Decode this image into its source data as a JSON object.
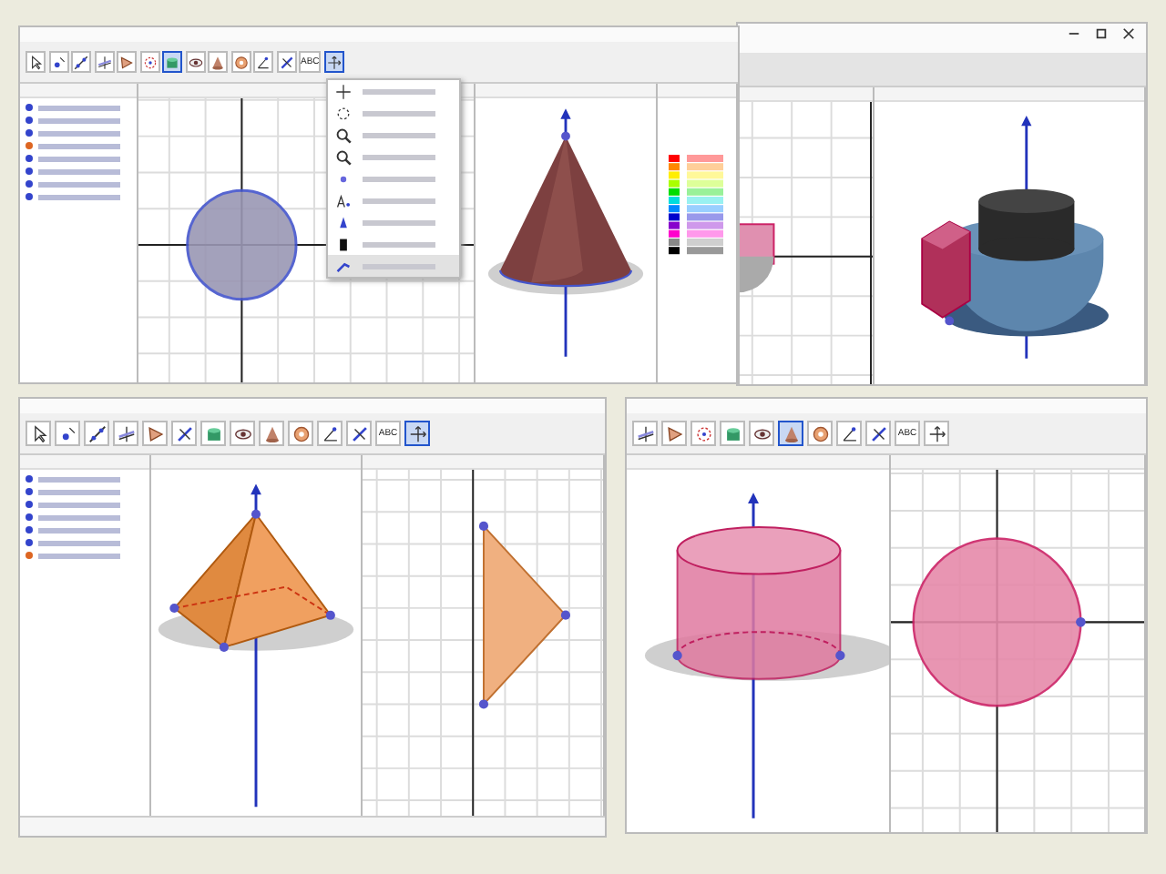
{
  "windows": [
    {
      "toolbar": [
        {
          "kind": "move",
          "selected": false
        },
        {
          "kind": "point",
          "selected": false
        },
        {
          "kind": "line",
          "selected": false
        },
        {
          "kind": "perp",
          "selected": false
        },
        {
          "kind": "polygon",
          "selected": false
        },
        {
          "kind": "circle",
          "selected": false
        },
        {
          "kind": "solid",
          "selected": true
        },
        {
          "kind": "eye",
          "selected": false
        },
        {
          "kind": "cone",
          "selected": false
        },
        {
          "kind": "sphere",
          "selected": false
        },
        {
          "kind": "angle",
          "selected": false
        },
        {
          "kind": "reflect",
          "selected": false
        },
        {
          "kind": "text",
          "label": "ABC",
          "selected": false
        },
        {
          "kind": "view",
          "selected": true
        }
      ],
      "dropdown": {
        "items": [
          {
            "kind": "move-view",
            "selected": false
          },
          {
            "kind": "rotate",
            "selected": false
          },
          {
            "kind": "zoom-in",
            "selected": false
          },
          {
            "kind": "zoom-out",
            "selected": false
          },
          {
            "kind": "show-hide",
            "selected": false
          },
          {
            "kind": "label",
            "selected": false
          },
          {
            "kind": "style",
            "selected": false
          },
          {
            "kind": "delete",
            "selected": false
          },
          {
            "kind": "view",
            "selected": true
          }
        ]
      },
      "views": [
        {
          "kind": "algebra",
          "rows": [
            {
              "color": "#3344cc"
            },
            {
              "color": "#3344cc"
            },
            {
              "color": "#3344cc"
            },
            {
              "color": "#dd6622"
            },
            {
              "color": "#3344cc"
            },
            {
              "color": "#3344cc"
            },
            {
              "color": "#3344cc"
            },
            {
              "color": "#3344cc"
            }
          ]
        },
        {
          "kind": "circle-2d"
        },
        {
          "kind": "cone-3d"
        },
        {
          "kind": "style-panel"
        }
      ]
    },
    {
      "views": [
        {
          "kind": "partial-2d"
        },
        {
          "kind": "solids-3d"
        }
      ]
    },
    {
      "toolbar": [
        {
          "kind": "move",
          "selected": false
        },
        {
          "kind": "point",
          "selected": false
        },
        {
          "kind": "line",
          "selected": false
        },
        {
          "kind": "perp",
          "selected": false
        },
        {
          "kind": "polygon",
          "selected": false
        },
        {
          "kind": "reflect",
          "selected": false
        },
        {
          "kind": "solid",
          "selected": false
        },
        {
          "kind": "eye",
          "selected": false
        },
        {
          "kind": "cone",
          "selected": false
        },
        {
          "kind": "sphere",
          "selected": false
        },
        {
          "kind": "angle",
          "selected": false
        },
        {
          "kind": "reflect",
          "selected": false
        },
        {
          "kind": "text",
          "label": "ABC",
          "selected": false
        },
        {
          "kind": "view",
          "selected": true
        }
      ],
      "views": [
        {
          "kind": "algebra",
          "rows": [
            {
              "color": "#3344cc"
            },
            {
              "color": "#3344cc"
            },
            {
              "color": "#3344cc"
            },
            {
              "color": "#3344cc"
            },
            {
              "color": "#3344cc"
            },
            {
              "color": "#3344cc"
            },
            {
              "color": "#dd6622"
            }
          ]
        },
        {
          "kind": "pyramid-3d"
        },
        {
          "kind": "triangle-2d"
        }
      ]
    },
    {
      "toolbar": [
        {
          "kind": "perp",
          "selected": false
        },
        {
          "kind": "polygon",
          "selected": false
        },
        {
          "kind": "circle",
          "selected": false
        },
        {
          "kind": "solid",
          "selected": false
        },
        {
          "kind": "eye",
          "selected": false
        },
        {
          "kind": "cone",
          "selected": true
        },
        {
          "kind": "sphere",
          "selected": false
        },
        {
          "kind": "angle",
          "selected": false
        },
        {
          "kind": "reflect",
          "selected": false
        },
        {
          "kind": "text",
          "label": "ABC",
          "selected": false
        },
        {
          "kind": "view",
          "selected": false
        }
      ],
      "views": [
        {
          "kind": "cylinder-3d"
        },
        {
          "kind": "circle-pink-2d"
        }
      ]
    }
  ]
}
